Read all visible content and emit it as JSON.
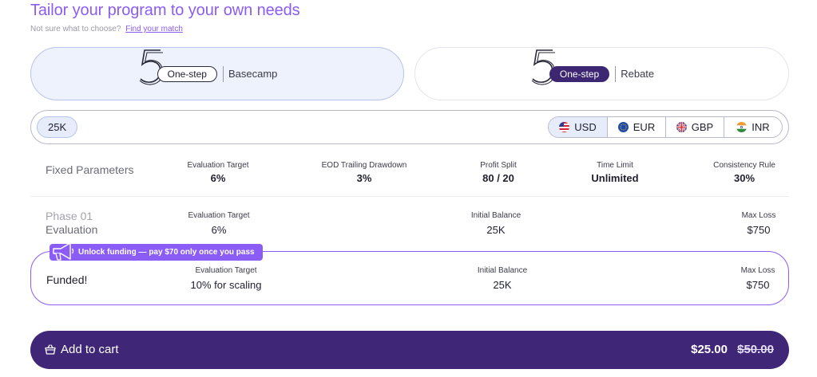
{
  "header": {
    "title": "Tailor your program to your own needs",
    "help_text": "Not sure what to choose?",
    "help_link": "Find your match"
  },
  "plans": [
    {
      "number": "5",
      "step": "One-step",
      "name": "Basecamp",
      "selected": true
    },
    {
      "number": "5",
      "step": "One-step",
      "name": "Rebate",
      "selected": false
    }
  ],
  "account_size": {
    "selected": "25K"
  },
  "currencies": [
    {
      "code": "USD",
      "icon": "us-flag-icon",
      "selected": true
    },
    {
      "code": "EUR",
      "icon": "eu-flag-icon",
      "selected": false
    },
    {
      "code": "GBP",
      "icon": "uk-flag-icon",
      "selected": false
    },
    {
      "code": "INR",
      "icon": "india-flag-icon",
      "selected": false
    }
  ],
  "fixed_parameters": {
    "label": "Fixed Parameters",
    "items": [
      {
        "label": "Evaluation Target",
        "value": "6%"
      },
      {
        "label": "EOD Trailing Drawdown",
        "value": "3%"
      },
      {
        "label": "Profit Split",
        "value": "80 / 20"
      },
      {
        "label": "Time Limit",
        "value": "Unlimited"
      },
      {
        "label": "Consistency Rule",
        "value": "30%"
      }
    ]
  },
  "phase": {
    "title": "Phase 01",
    "subtitle": "Evaluation",
    "items": [
      {
        "label": "Evaluation Target",
        "value": "6%"
      },
      {
        "label": "Initial Balance",
        "value": "25K"
      },
      {
        "label": "Max Loss",
        "value": "$750"
      }
    ]
  },
  "funded": {
    "badge": "Unlock funding — pay $70 only once you pass",
    "label": "Funded!",
    "items": [
      {
        "label": "Evaluation Target",
        "value": "10% for scaling"
      },
      {
        "label": "Initial Balance",
        "value": "25K"
      },
      {
        "label": "Max Loss",
        "value": "$750"
      }
    ]
  },
  "cart": {
    "label": "Add to cart",
    "price": "$25.00",
    "old_price": "$50.00"
  },
  "colors": {
    "accent": "#8b5cf6",
    "dark_purple": "#3f2677",
    "selected_bg": "#eef2fd"
  }
}
